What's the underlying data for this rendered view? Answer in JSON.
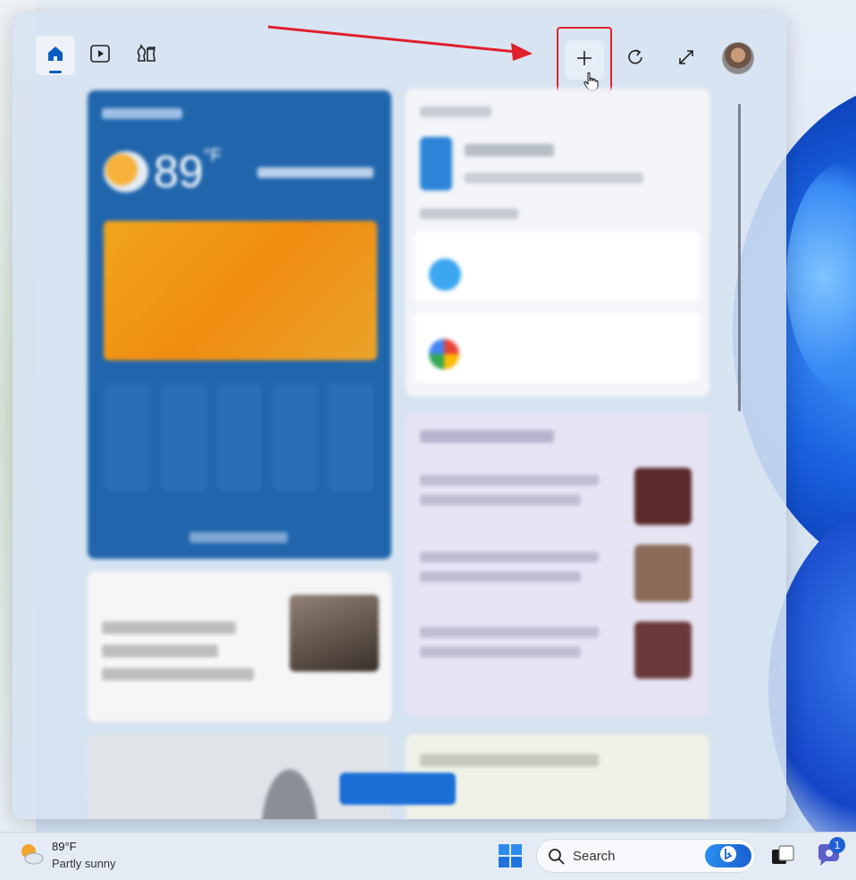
{
  "panel": {
    "nav_items": [
      {
        "name": "home",
        "icon": "home-icon",
        "active": true
      },
      {
        "name": "watch",
        "icon": "play-icon",
        "active": false
      },
      {
        "name": "games",
        "icon": "chess-icon",
        "active": false
      }
    ],
    "actions": [
      {
        "name": "add-widgets",
        "icon": "plus-icon",
        "highlighted": true
      },
      {
        "name": "refresh",
        "icon": "refresh-icon"
      },
      {
        "name": "expand",
        "icon": "expand-icon"
      },
      {
        "name": "profile",
        "icon": "avatar"
      }
    ],
    "weather_card": {
      "temperature": "89",
      "unit": "°F"
    }
  },
  "taskbar": {
    "weather_temp": "89°F",
    "weather_condition": "Partly sunny",
    "search_label": "Search",
    "chat_badge_count": "1"
  },
  "colors": {
    "accent": "#0a5cc2",
    "annotation_red": "#e0202a",
    "weather_card_blue": "#2166ac",
    "bing_blue": "#1a5fd0"
  }
}
